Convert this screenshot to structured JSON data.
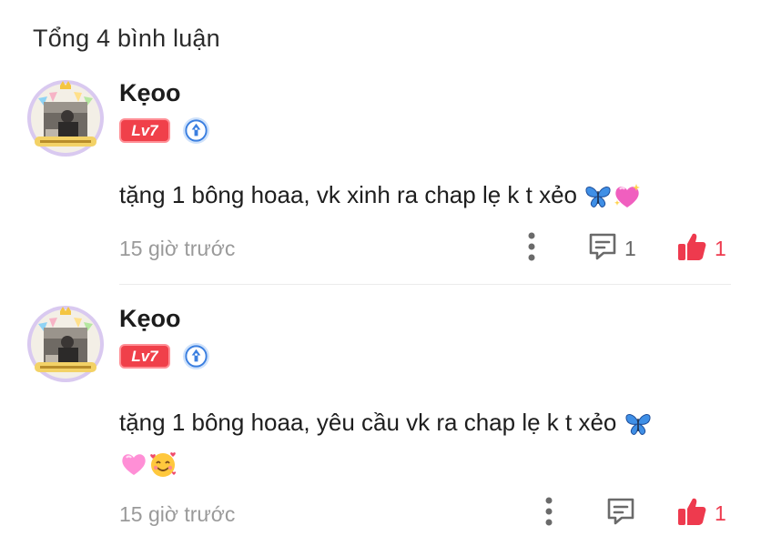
{
  "header": {
    "title": "Tổng 4 bình luận"
  },
  "colors": {
    "accent_red": "#ee3a4e",
    "level_badge": "#f0404a",
    "pen_badge": "#3b7fe0",
    "muted": "#9a9a9a"
  },
  "comments": [
    {
      "username": "Kẹoo",
      "level": "Lv7",
      "text": "tặng 1 bông hoaa, vk xinh ra chap lẹ k t xẻo",
      "emojis": [
        "butterfly-emoji",
        "sparkling-heart-emoji"
      ],
      "time": "15 giờ trước",
      "reply_count": "1",
      "like_count": "1",
      "icons": [
        "more-icon",
        "reply-icon",
        "like-icon"
      ]
    },
    {
      "username": "Kẹoo",
      "level": "Lv7",
      "text": "tặng 1 bông hoaa, yêu cầu vk ra chap lẹ k t xẻo",
      "emojis": [
        "butterfly-emoji",
        "pink-heart-emoji",
        "smiling-face-with-hearts-emoji"
      ],
      "time": "15 giờ trước",
      "like_count": "1",
      "icons": [
        "more-icon",
        "reply-icon",
        "like-icon"
      ]
    }
  ]
}
